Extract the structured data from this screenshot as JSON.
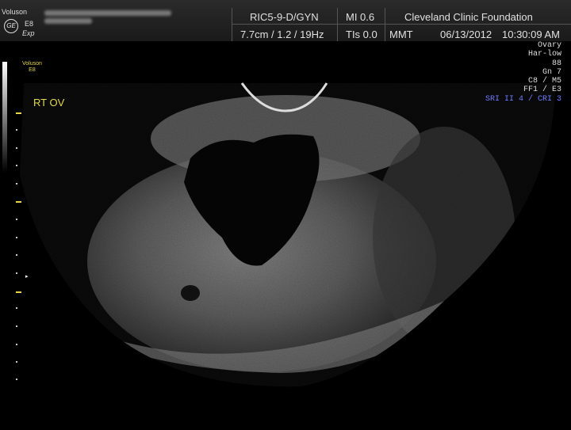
{
  "logo": {
    "brand": "Voluson",
    "symbol": "GE",
    "model": "E8",
    "mode": "Exp"
  },
  "header": {
    "probe": "RIC5-9-D/GYN",
    "mi": "MI  0.6",
    "institution": "Cleveland Clinic Foundation",
    "depth_freq": "7.7cm / 1.2 / 19Hz",
    "tis": "TIs  0.0",
    "mmt": "MMT",
    "date": "06/13/2012",
    "time": "10:30:09 AM"
  },
  "side": {
    "brand": "Voluson",
    "model": "E8",
    "label": "RT OV"
  },
  "params": {
    "preset": "Ovary",
    "harmonic": "Har-low",
    "power": "88",
    "gain": "Gn   7",
    "c_m": "C8 / M5",
    "ff_e": "FF1 / E3",
    "sri_cri": "SRI II 4 / CRI 3"
  },
  "colors": {
    "annotation": "#e6d84a",
    "sri": "#6f7dff",
    "header_bg": "#222222"
  }
}
